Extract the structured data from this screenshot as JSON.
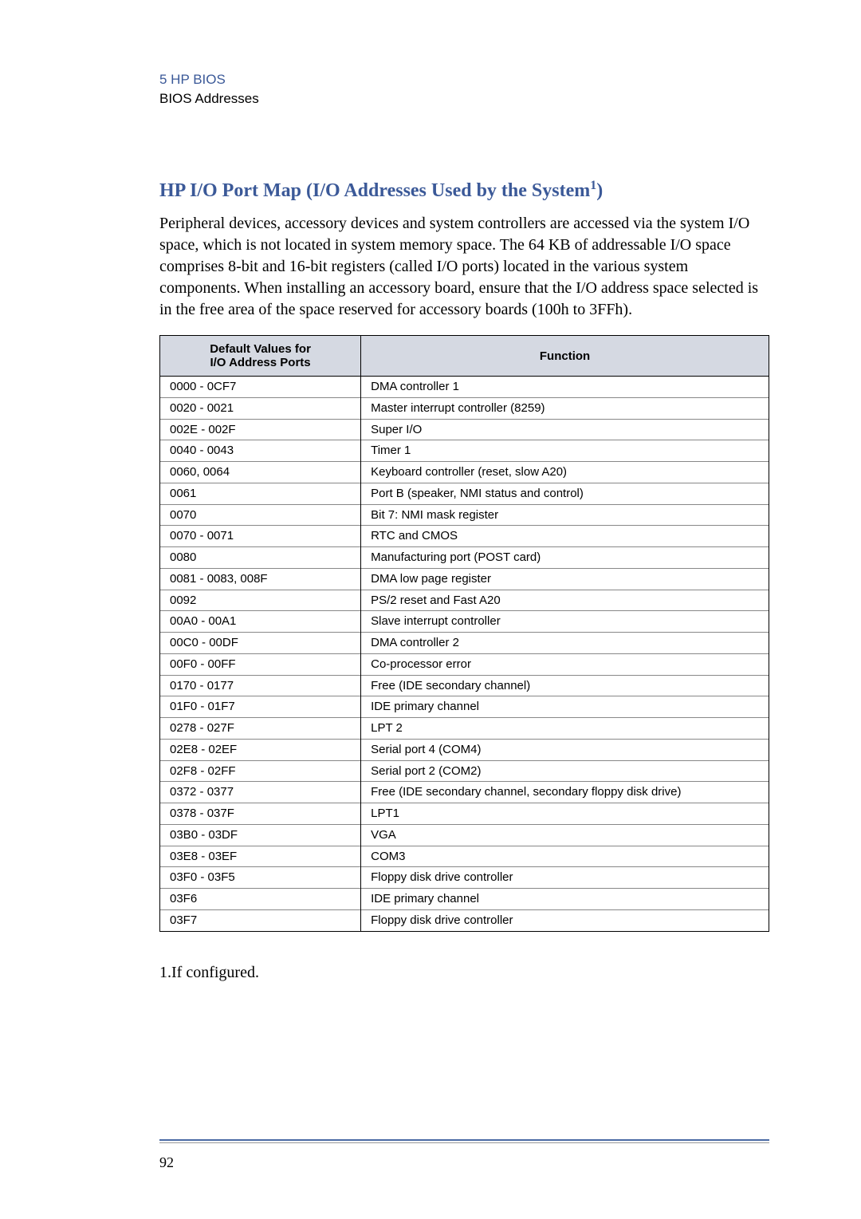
{
  "header": {
    "chapter": "5   HP BIOS",
    "section": "BIOS Addresses"
  },
  "heading_pre": "HP I/O Port Map (I/O Addresses Used by the System",
  "heading_sup": "1",
  "heading_post": ")",
  "paragraph": "Peripheral devices, accessory devices and system controllers are accessed via the system I/O space, which is not located in system memory space. The 64 KB of addressable I/O space comprises 8-bit and 16-bit registers (called I/O ports) located in the various system components. When installing an accessory board, ensure that the I/O address space selected is in the free area of the space reserved for accessory boards (100h to 3FFh).",
  "table": {
    "headers": {
      "col1_line1": "Default Values for",
      "col1_line2": "I/O Address Ports",
      "col2": "Function"
    },
    "rows": [
      {
        "addr": "0000 - 0CF7",
        "func": "DMA controller 1"
      },
      {
        "addr": "0020 - 0021",
        "func": "Master interrupt controller (8259)"
      },
      {
        "addr": "002E - 002F",
        "func": "Super I/O"
      },
      {
        "addr": "0040 - 0043",
        "func": "Timer 1"
      },
      {
        "addr": "0060, 0064",
        "func": "Keyboard controller (reset, slow A20)"
      },
      {
        "addr": "0061",
        "func": "Port B (speaker, NMI status and control)"
      },
      {
        "addr": "0070",
        "func": "Bit 7: NMI mask register"
      },
      {
        "addr": "0070 - 0071",
        "func": "RTC and CMOS"
      },
      {
        "addr": "0080",
        "func": "Manufacturing port (POST card)"
      },
      {
        "addr": "0081 - 0083, 008F",
        "func": "DMA low page register"
      },
      {
        "addr": "0092",
        "func": "PS/2 reset and Fast A20"
      },
      {
        "addr": "00A0 - 00A1",
        "func": "Slave interrupt controller"
      },
      {
        "addr": "00C0 - 00DF",
        "func": "DMA controller 2"
      },
      {
        "addr": "00F0 - 00FF",
        "func": "Co-processor error"
      },
      {
        "addr": "0170 - 0177",
        "func": "Free (IDE secondary channel)"
      },
      {
        "addr": "01F0 - 01F7",
        "func": "IDE primary channel"
      },
      {
        "addr": "0278 - 027F",
        "func": "LPT 2"
      },
      {
        "addr": "02E8 - 02EF",
        "func": "Serial port 4 (COM4)"
      },
      {
        "addr": "02F8 - 02FF",
        "func": "Serial port 2 (COM2)"
      },
      {
        "addr": "0372 - 0377",
        "func": "Free (IDE secondary channel, secondary floppy disk drive)"
      },
      {
        "addr": "0378 - 037F",
        "func": "LPT1"
      },
      {
        "addr": "03B0 - 03DF",
        "func": "VGA"
      },
      {
        "addr": "03E8 - 03EF",
        "func": "COM3"
      },
      {
        "addr": "03F0 - 03F5",
        "func": "Floppy disk drive controller"
      },
      {
        "addr": "03F6",
        "func": "IDE primary channel"
      },
      {
        "addr": "03F7",
        "func": "Floppy disk drive controller"
      }
    ]
  },
  "footnote": "1.If configured.",
  "page_number": "92"
}
